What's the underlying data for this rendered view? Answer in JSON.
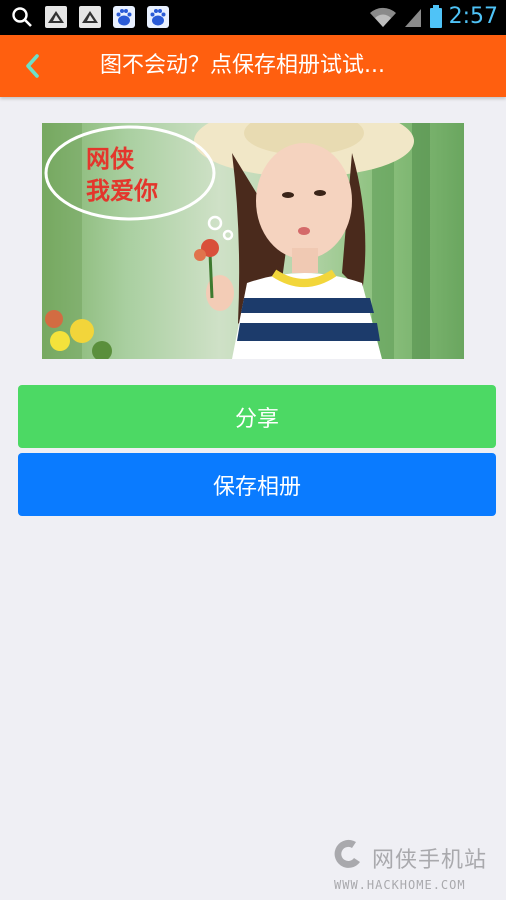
{
  "status_bar": {
    "time": "2:57",
    "icons": [
      "search-icon",
      "notification-app-icon",
      "notification-app-icon",
      "baidu-paw-icon",
      "baidu-paw-icon"
    ],
    "right_icons": [
      "wifi-icon",
      "signal-icon",
      "battery-icon"
    ]
  },
  "header": {
    "back_icon": "chevron-left-icon",
    "title": "图不会动？点保存相册试试..."
  },
  "image": {
    "bubble_text_line1": "网侠",
    "bubble_text_line2": "我爱你"
  },
  "buttons": {
    "share_label": "分享",
    "save_label": "保存相册"
  },
  "watermark": {
    "name": "网侠手机站",
    "url": "WWW.HACKHOME.COM"
  },
  "colors": {
    "header_bg": "#ff5f0f",
    "share_bg": "#4cd964",
    "save_bg": "#0a7bff",
    "back_arrow": "#6ee0c8",
    "time": "#4fc3f7"
  }
}
